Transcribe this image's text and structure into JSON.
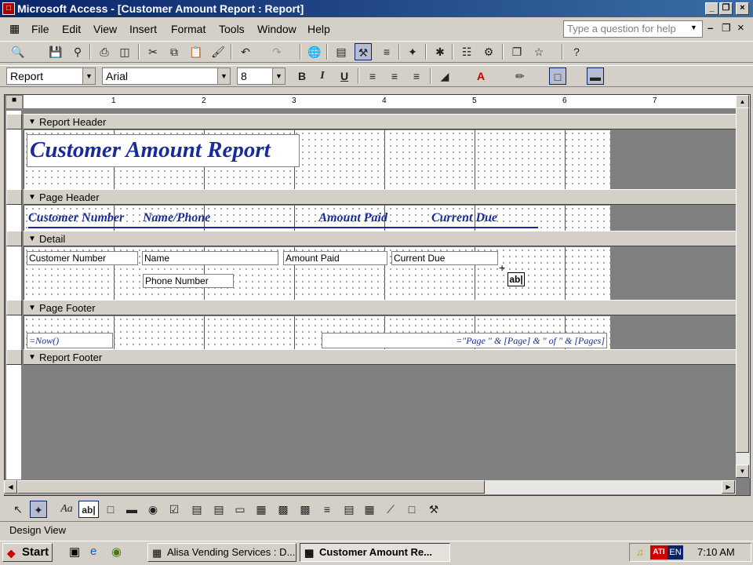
{
  "window": {
    "title": "Microsoft Access - [Customer Amount Report : Report]"
  },
  "menu": [
    "File",
    "Edit",
    "View",
    "Insert",
    "Format",
    "Tools",
    "Window",
    "Help"
  ],
  "help_box": {
    "placeholder": "Type a question for help"
  },
  "format_bar": {
    "object": "Report",
    "font": "Arial",
    "size": "8"
  },
  "ruler": {
    "marks": [
      "1",
      "2",
      "3",
      "4",
      "5",
      "6",
      "7"
    ]
  },
  "sections": {
    "report_header": "Report Header",
    "page_header": "Page Header",
    "detail": "Detail",
    "page_footer": "Page Footer",
    "report_footer": "Report Footer"
  },
  "report_title": "Customer Amount Report",
  "page_header_labels": [
    "Customer Number",
    "Name/Phone",
    "Amount Paid",
    "Current Due"
  ],
  "detail_fields": {
    "customer_number": "Customer Number",
    "name": "Name",
    "amount_paid": "Amount Paid",
    "current_due": "Current Due",
    "phone": "Phone Number"
  },
  "page_footer": {
    "date": "=Now()",
    "pages": "=\"Page \" & [Page] & \" of \" & [Pages]"
  },
  "textbox_tool": "ab|",
  "status": "Design View",
  "taskbar": {
    "start": "Start",
    "task1": "Alisa Vending Services : D...",
    "task2": "Customer Amount Re...",
    "clock": "7:10 AM",
    "lang": "EN"
  },
  "colors": {
    "title_blue": "#1a2a9a",
    "titlebar": "#0a246a"
  }
}
